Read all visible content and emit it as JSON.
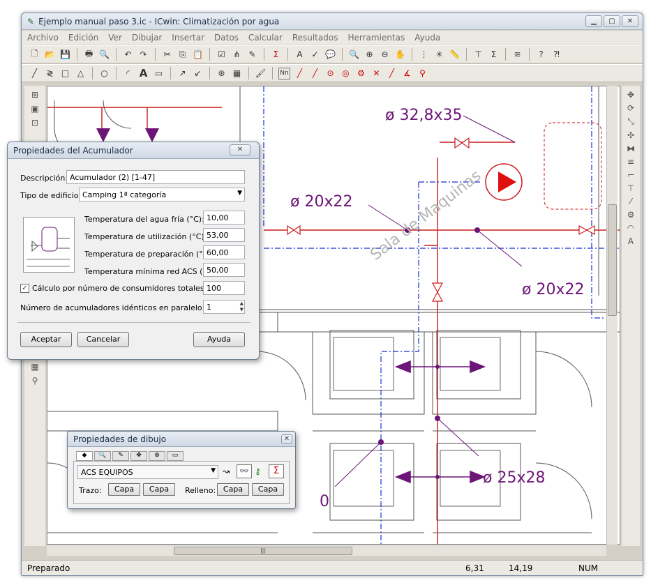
{
  "window": {
    "title": "Ejemplo manual paso 3.ic - ICwin: Climatización por agua"
  },
  "menu": [
    "Archivo",
    "Edición",
    "Ver",
    "Dibujar",
    "Insertar",
    "Datos",
    "Calcular",
    "Resultados",
    "Herramientas",
    "Ayuda"
  ],
  "drawing": {
    "labels": [
      "ø 32,8x35",
      "ø 20x22",
      "ø 20x22",
      "ø 25x28",
      "0"
    ],
    "watermark": "Sala de Maquinas"
  },
  "acumulador": {
    "title": "Propiedades del Acumulador",
    "descripcion_label": "Descripción:",
    "descripcion_value": "Acumulador (2) [1-47]",
    "tipo_label": "Tipo de edificio:",
    "tipo_value": "Camping 1ª categoría",
    "temp_fria_label": "Temperatura del agua fría (°C):",
    "temp_fria_value": "10,00",
    "temp_util_label": "Temperatura de utilización (°C):",
    "temp_util_value": "53,00",
    "temp_prep_label": "Temperatura de preparación (°C):",
    "temp_prep_value": "60,00",
    "temp_min_label": "Temperatura mínima red ACS (°C):",
    "temp_min_value": "50,00",
    "calculo_label": "Cálculo por número de consumidores totales:",
    "calculo_value": "100",
    "num_acum_label": "Número de acumuladores idénticos en paralelo:",
    "num_acum_value": "1",
    "aceptar": "Aceptar",
    "cancelar": "Cancelar",
    "ayuda": "Ayuda"
  },
  "dibujo": {
    "title": "Propiedades de dibujo",
    "layer_value": "ACS EQUIPOS",
    "trazo_label": "Trazo:",
    "relleno_label": "Relleno:",
    "capa": "Capa"
  },
  "status": {
    "text": "Preparado",
    "x": "6,31",
    "y": "14,19",
    "mode": "NUM"
  },
  "colors": {
    "red": "#cc1b1b",
    "purple": "#6d1479",
    "blue": "#1a2fd0"
  }
}
